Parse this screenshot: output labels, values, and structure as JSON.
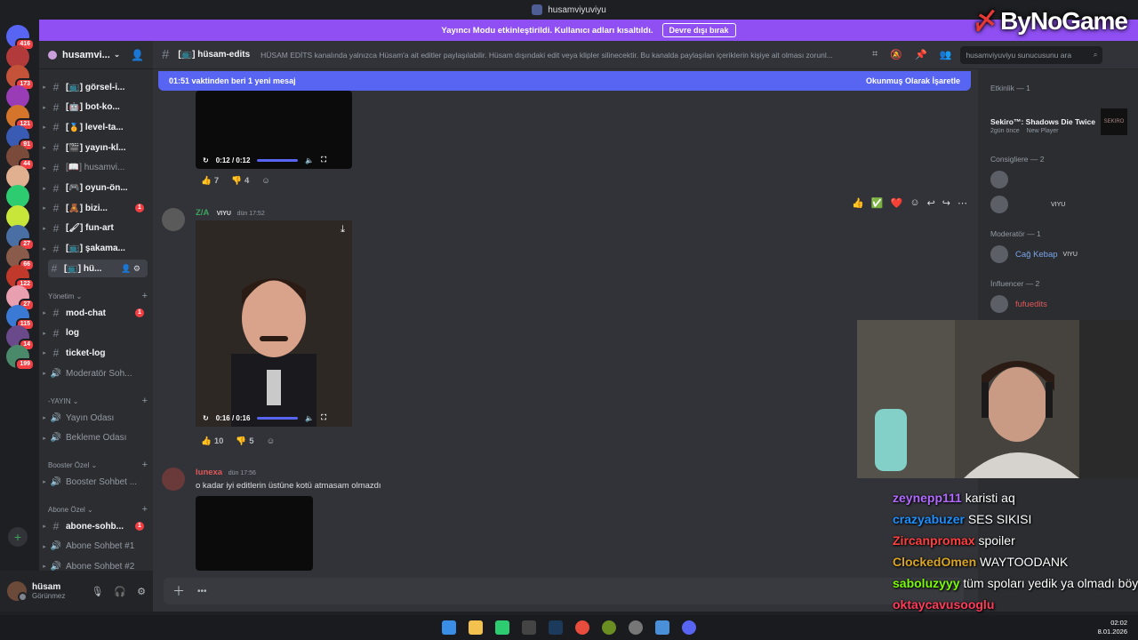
{
  "window": {
    "title": "husamviyuviyu"
  },
  "watermark": "ByNoGame",
  "banner": {
    "text": "Yayıncı Modu etkinleştirildi. Kullanıcı adları kısaltıldı.",
    "button": "Devre dışı bırak"
  },
  "servers": [
    {
      "color": "#5865f2",
      "badge": "416"
    },
    {
      "color": "#b33a3a",
      "badge": ""
    },
    {
      "color": "#c4533a",
      "badge": "173"
    },
    {
      "color": "#9b3cb7",
      "badge": ""
    },
    {
      "color": "#d4752b",
      "badge": "121"
    },
    {
      "color": "#3a5bb3",
      "badge": "91"
    },
    {
      "color": "#7a4a3a",
      "badge": "44"
    },
    {
      "color": "#e0b090",
      "badge": ""
    },
    {
      "color": "#2ecc71",
      "badge": ""
    },
    {
      "color": "#c8e63a",
      "badge": ""
    },
    {
      "color": "#4a6fa5",
      "badge": "27"
    },
    {
      "color": "#8a5a4a",
      "badge": "66"
    },
    {
      "color": "#c0392b",
      "badge": "122"
    },
    {
      "color": "#e8a0b0",
      "badge": "27"
    },
    {
      "color": "#3a7ad4",
      "badge": "115"
    },
    {
      "color": "#6a4a8a",
      "badge": "14"
    },
    {
      "color": "#4a8a6a",
      "badge": "199"
    }
  ],
  "guild": {
    "name": "husamvi..."
  },
  "channels": [
    {
      "name": "[📺] görsel-i...",
      "type": "text",
      "bold": true
    },
    {
      "name": "[🤖] bot-ko...",
      "type": "text",
      "bold": true
    },
    {
      "name": "[🏅] level-ta...",
      "type": "text",
      "bold": true
    },
    {
      "name": "[🎬] yayın-kl...",
      "type": "text",
      "bold": true
    },
    {
      "name": "[📖] husamvi...",
      "type": "text",
      "bold": false
    },
    {
      "name": "[🎮] oyun-ön...",
      "type": "text",
      "bold": true
    },
    {
      "name": "[🧸] bizi...",
      "type": "text",
      "bold": true,
      "unread": "1"
    },
    {
      "name": "[🖌] fun-art",
      "type": "text",
      "bold": true
    },
    {
      "name": "[📺] şakama...",
      "type": "text",
      "bold": true
    },
    {
      "name": "[📺] hü...",
      "type": "text",
      "bold": true,
      "active": true
    }
  ],
  "categories": {
    "yonetim": "Yönetim",
    "yayin": "-YAYIN",
    "booster": "Booster Özel",
    "abone": "Abone Özel"
  },
  "yonetim_channels": [
    {
      "name": "mod-chat",
      "type": "text",
      "bold": true,
      "unread": "1"
    },
    {
      "name": "log",
      "type": "text",
      "bold": true
    },
    {
      "name": "ticket-log",
      "type": "text",
      "bold": true
    },
    {
      "name": "Moderatör Soh...",
      "type": "voice",
      "bold": false
    }
  ],
  "yayin_channels": [
    {
      "name": "Yayın Odası",
      "type": "voice"
    },
    {
      "name": "Bekleme Odası",
      "type": "voice"
    }
  ],
  "booster_channels": [
    {
      "name": "Booster Sohbet ...",
      "type": "voice"
    }
  ],
  "abone_channels": [
    {
      "name": "abone-sohb...",
      "type": "text",
      "bold": true,
      "unread": "1"
    },
    {
      "name": "Abone Sohbet #1",
      "type": "voice"
    },
    {
      "name": "Abone Sohbet #2",
      "type": "voice"
    }
  ],
  "user": {
    "name": "hüsam",
    "status": "Görünmez"
  },
  "header": {
    "channel": "[📺] hüsam-edits",
    "topic": "HÜSAM EDİTS kanalında yalnızca Hüsam'a ait editler paylaşılabilir. Hüsam dışındaki edit veya klipler silinecektir. Bu kanalda paylaşılan içeriklerin kişiye ait olması zorunl...",
    "search_placeholder": "husamviyuviyu sunucusunu ara"
  },
  "newbar": {
    "text": "01:51 vaktinden beri 1 yeni mesaj",
    "mark": "Okunmuş Olarak İşaretle"
  },
  "messages": [
    {
      "video_time": "0:12 / 0:12",
      "reactions": [
        {
          "emoji": "👍",
          "count": "7"
        },
        {
          "emoji": "👎",
          "count": "4"
        }
      ]
    },
    {
      "author": "Z/A",
      "author_color": "#3ba55c",
      "tag": "VIYU",
      "time": "dün 17:52",
      "video_time": "0:16 / 0:16",
      "reactions": [
        {
          "emoji": "👍",
          "count": "10"
        },
        {
          "emoji": "👎",
          "count": "5"
        }
      ]
    },
    {
      "author": "lunexa",
      "author_color": "#e0585a",
      "time": "dün 17:56",
      "text": "o kadar iyi editlerin üstüne kotü atmasam olmazdı"
    }
  ],
  "members": {
    "activity_cat": "Etkinlik — 1",
    "activity_title": "Sekiro™: Shadows Die Twice",
    "activity_sub": "2gün önce",
    "activity_badge": "New Player",
    "consigliere_cat": "Consigliere — 2",
    "moderator_cat": "Moderatör — 1",
    "moderator_name": "Cağ Kebap",
    "moderator_tag": "VIYU",
    "consigliere_tag": "VIYU",
    "influencer_cat": "İnfluencer — 2",
    "influencer_name": "fufuedits"
  },
  "chat_overlay": [
    {
      "user": "zeynepp111",
      "color": "#b36bff",
      "msg": "karisti aq"
    },
    {
      "user": "crazyabuzer",
      "color": "#1e90ff",
      "msg": "SES SIKISI"
    },
    {
      "user": "Zircanpromax",
      "color": "#ff4040",
      "msg": "spoiler"
    },
    {
      "user": "ClockedOmen",
      "color": "#daa520",
      "msg": "WAYTOODANK"
    },
    {
      "user": "saboluzyyy",
      "color": "#7cfc00",
      "msg": "tüm spoları yedik ya olmadı böyle"
    },
    {
      "user": "oktaycavusooglu",
      "color": "#ff3c5a",
      "msg": ""
    }
  ],
  "clock": {
    "time": "02:02",
    "date": "8.01.2026"
  }
}
